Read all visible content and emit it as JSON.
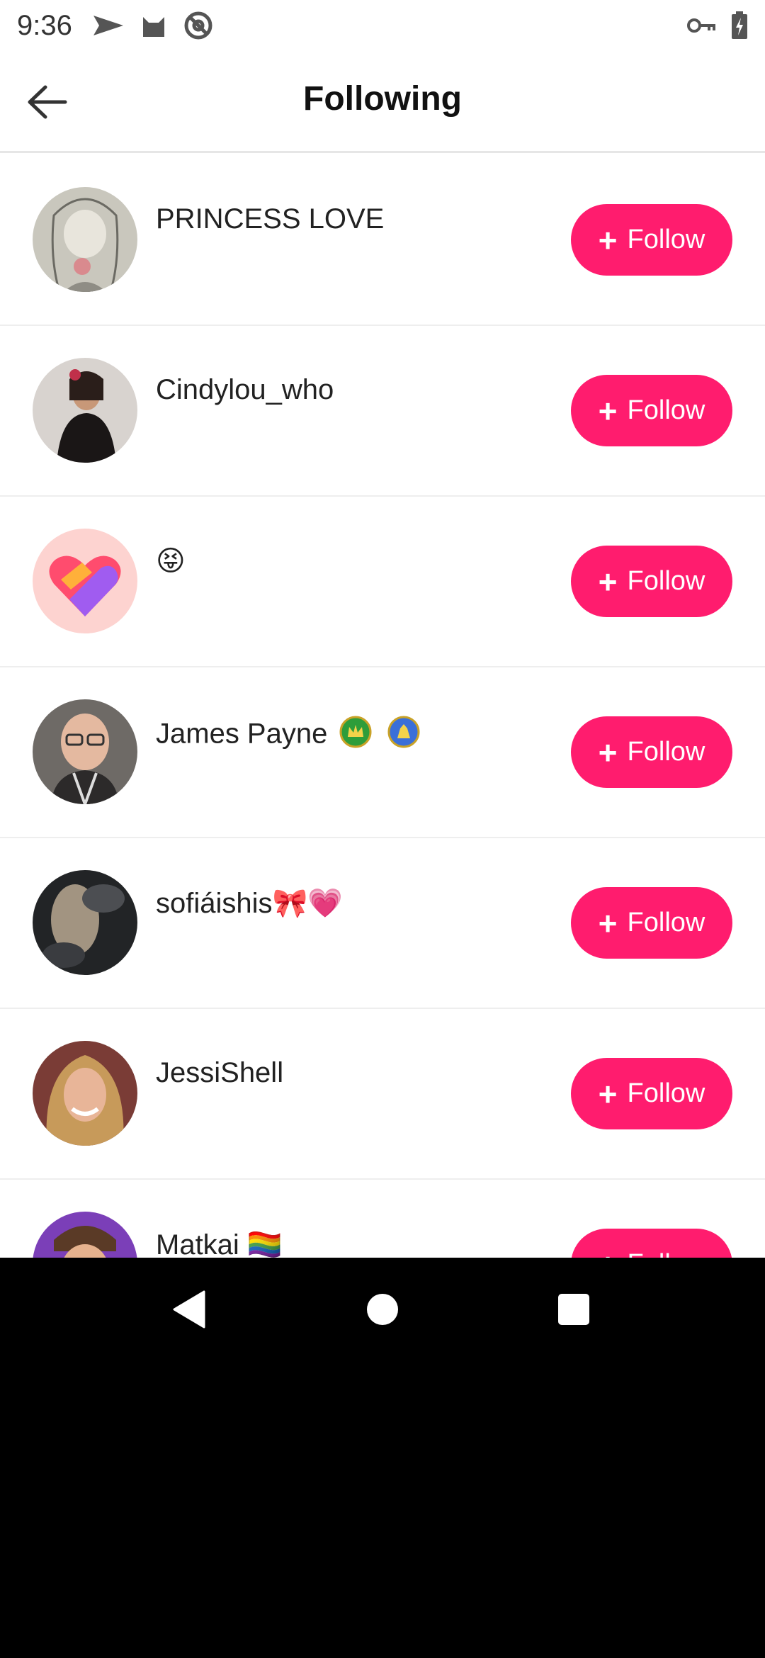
{
  "status_bar": {
    "time": "9:36",
    "icons": [
      "send-icon",
      "cat-icon",
      "at-sign-icon",
      "key-icon",
      "battery-icon"
    ]
  },
  "header": {
    "title": "Following"
  },
  "colors": {
    "accent": "#ff1c6e",
    "text": "#222222",
    "divider": "#eeeeee"
  },
  "users": [
    {
      "name": "PRINCESS LOVE",
      "follow_label": "Follow",
      "avatar": "illustrated-girl-avatar"
    },
    {
      "name": "Cindylou_who",
      "follow_label": "Follow",
      "avatar": "woman-photo-avatar"
    },
    {
      "name": "😝",
      "follow_label": "Follow",
      "avatar": "heart-logo-avatar"
    },
    {
      "name": "James Payne",
      "follow_label": "Follow",
      "avatar": "man-photo-avatar",
      "badges": [
        "green-crown-badge",
        "blue-badge"
      ]
    },
    {
      "name": "sofiáishis🎀💗",
      "follow_label": "Follow",
      "avatar": "blurry-photo-avatar"
    },
    {
      "name": "JessiShell",
      "follow_label": "Follow",
      "avatar": "woman-smiling-avatar"
    },
    {
      "name": "Matkai 🏳️‍🌈",
      "follow_label": "Follow",
      "avatar": "man-cap-avatar"
    }
  ],
  "nav": {
    "icons": [
      "back-triangle-icon",
      "home-circle-icon",
      "recents-square-icon"
    ]
  }
}
